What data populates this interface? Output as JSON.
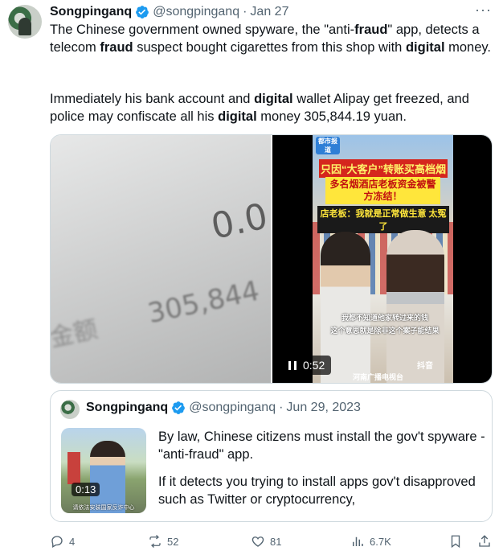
{
  "tweet": {
    "author": {
      "display_name": "Songpinganq",
      "handle": "@songpinganq"
    },
    "separator": "·",
    "date": "Jan 27",
    "more_icon": "more-icon",
    "text": {
      "p1_a": "The Chinese government owned spyware, the \"anti-",
      "p1_b": "fraud",
      "p1_c": "\" app, detects a telecom ",
      "p1_d": "fraud",
      "p1_e": " suspect bought cigarettes from this shop with ",
      "p1_f": "digital",
      "p1_g": " money.",
      "p2_a": "Immediately his bank account and ",
      "p2_b": "digital",
      "p2_c": " wallet Alipay get freezed, and police may confiscate all his ",
      "p2_d": "digital",
      "p2_e": " money 305,844.19 yuan."
    },
    "media": {
      "photo_text": [
        "0.0",
        "305,844",
        "金额"
      ],
      "video": {
        "duration": "0:52",
        "badge": "都市报道",
        "banner_1": "只因“大客户”转账买高档烟",
        "banner_2": "多名烟酒店老板资金被警方冻结！",
        "banner_3": "店老板：我就是正常做生意 太冤了",
        "subtitle_1": "我都不知道他家转过来的钱",
        "subtitle_2": "这个意思就是除非这个案子能结果",
        "platform": "抖音",
        "station": "河南广播电视台"
      }
    },
    "quote": {
      "author": {
        "display_name": "Songpinganq",
        "handle": "@songpinganq"
      },
      "date": "Jun 29, 2023",
      "video_duration": "0:13",
      "thumb_caption": "请依法安装国家反诈中心",
      "para_1": "By law, Chinese citizens must install the gov't spyware - \"anti-fraud\" app.",
      "para_2": "If it detects you trying to install apps gov't disapproved such as Twitter or cryptocurrency,"
    },
    "actions": {
      "replies": "4",
      "reposts": "52",
      "likes": "81",
      "views": "6.7K"
    }
  },
  "colors": {
    "text": "#0f1419",
    "muted": "#536471",
    "verified": "#1d9bf0",
    "border": "#cfd9de"
  }
}
